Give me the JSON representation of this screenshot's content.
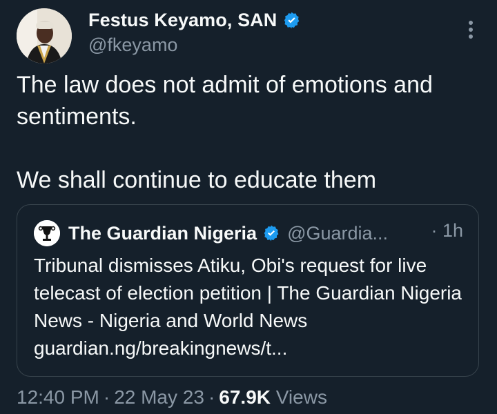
{
  "author": {
    "display_name": "Festus Keyamo, SAN",
    "handle": "@fkeyamo",
    "verified_icon": "verified-badge-icon"
  },
  "tweet": {
    "lines": [
      "The law does not admit of emotions and sentiments.",
      "We shall continue to educate them"
    ]
  },
  "quote": {
    "display_name": "The Guardian Nigeria",
    "handle": "@Guardia...",
    "time": "· 1h",
    "text": "Tribunal dismisses Atiku, Obi's request for live telecast of election petition | The Guardian Nigeria News - Nigeria and World News guardian.ng/breakingnews/t..."
  },
  "meta": {
    "time": "12:40 PM",
    "date": "22 May 23",
    "views_count": "67.9K",
    "views_label": "Views"
  },
  "colors": {
    "background": "#15202b",
    "text": "#f7f9f9",
    "secondary": "#8b98a5",
    "verified": "#1d9bf0",
    "border": "#38444d"
  }
}
